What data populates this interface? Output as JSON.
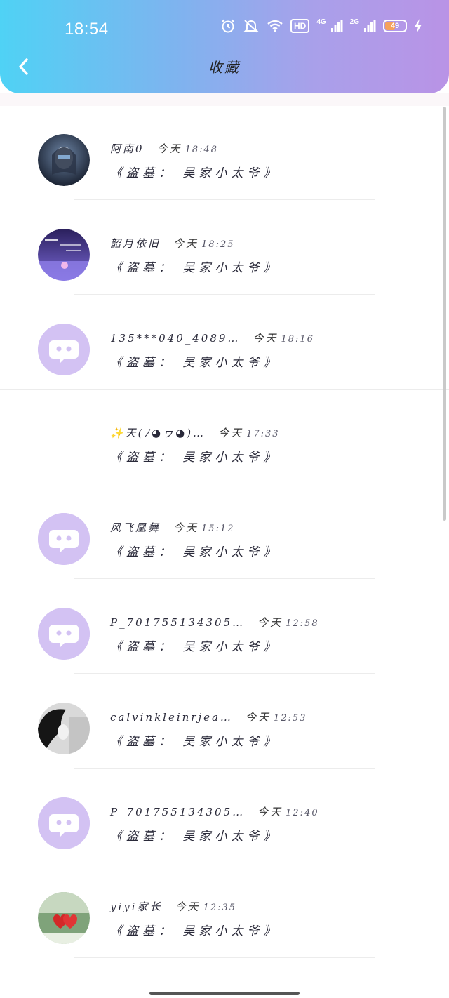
{
  "status_bar": {
    "time": "18:54",
    "hd_label": "HD",
    "net1_label": "4G",
    "net2_label": "2G",
    "battery_percent": "49",
    "battery_level": 0.49
  },
  "header": {
    "title": "收藏"
  },
  "items": [
    {
      "name": "阿南0",
      "day": "今天",
      "hm": "18:48",
      "title": "《盗墓： 吴家小太爷》",
      "avatar": "dark-portrait"
    },
    {
      "name": "韶月依旧",
      "day": "今天",
      "hm": "18:25",
      "title": "《盗墓： 吴家小太爷》",
      "avatar": "purple-night"
    },
    {
      "name": "135***040_4089…",
      "day": "今天",
      "hm": "18:16",
      "title": "《盗墓： 吴家小太爷》",
      "avatar": "default"
    },
    {
      "name": "✨天(ﾉ◕ヮ◕)…",
      "day": "今天",
      "hm": "17:33",
      "title": "《盗墓： 吴家小太爷》",
      "avatar": "none"
    },
    {
      "name": "风飞凰舞",
      "day": "今天",
      "hm": "15:12",
      "title": "《盗墓： 吴家小太爷》",
      "avatar": "default"
    },
    {
      "name": "P_701755134305…",
      "day": "今天",
      "hm": "12:58",
      "title": "《盗墓： 吴家小太爷》",
      "avatar": "default"
    },
    {
      "name": "calvinkleinrjea…",
      "day": "今天",
      "hm": "12:53",
      "title": "《盗墓： 吴家小太爷》",
      "avatar": "bw-portrait"
    },
    {
      "name": "P_701755134305…",
      "day": "今天",
      "hm": "12:40",
      "title": "《盗墓： 吴家小太爷》",
      "avatar": "default"
    },
    {
      "name": "yiyi家长",
      "day": "今天",
      "hm": "12:35",
      "title": "《盗墓： 吴家小太爷》",
      "avatar": "hearts"
    }
  ],
  "colors": {
    "header_gradient_start": "#4fd2f5",
    "header_gradient_end": "#b993e6",
    "default_avatar": "#d3c2f3"
  }
}
